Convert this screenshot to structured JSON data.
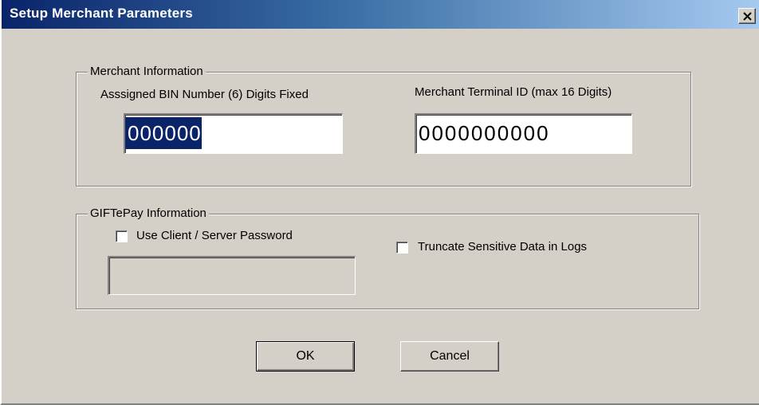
{
  "window": {
    "title": "Setup Merchant Parameters"
  },
  "merchant_info": {
    "legend": "Merchant Information",
    "bin_label": "Asssigned BIN Number (6) Digits Fixed",
    "bin_value": "000000",
    "terminal_label": "Merchant Terminal ID (max 16 Digits)",
    "terminal_value": "0000000000"
  },
  "giftepay_info": {
    "legend": "GIFTePay Information",
    "password_checkbox_label": "Use Client / Server Password",
    "password_checked": false,
    "password_value": "",
    "truncate_checkbox_label": "Truncate Sensitive Data in Logs",
    "truncate_checked": false
  },
  "buttons": {
    "ok_label": "OK",
    "cancel_label": "Cancel"
  },
  "colors": {
    "titlebar_start": "#0a246a",
    "titlebar_end": "#a6caf0",
    "face": "#d4d0c8",
    "selection": "#0a246a"
  }
}
